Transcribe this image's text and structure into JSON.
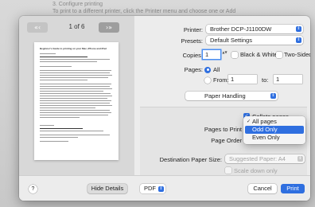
{
  "background": {
    "line1": "3. Configure printing",
    "line2": "To print to a different printer, click the Printer menu and choose one or Add"
  },
  "preview": {
    "page_count": "1 of 6",
    "first_btn": "«",
    "prev_btn": "‹",
    "next_btn": "›",
    "last_btn": "»",
    "thumbnail_title": "Beginner's Guide to printing on your Mac, iPhone and iPad"
  },
  "settings": {
    "printer_label": "Printer:",
    "printer_value": "Brother DCP-J1100DW",
    "presets_label": "Presets:",
    "presets_value": "Default Settings",
    "copies_label": "Copies:",
    "copies_value": "1",
    "bw_label": "Black & White",
    "two_sided_label": "Two-Sided",
    "pages_label": "Pages:",
    "pages_all": "All",
    "pages_from": "From:",
    "from_value": "1",
    "pages_to": "to:",
    "to_value": "1",
    "section_value": "Paper Handling",
    "collate_label": "Collate pages",
    "pages_to_print_label": "Pages to Print",
    "page_order_label": "Page Order",
    "dest_paper_label": "Destination Paper Size:",
    "dest_paper_value": "Suggested Paper: A4",
    "scale_down_label": "Scale down only"
  },
  "menu": {
    "items": [
      {
        "label": "All pages",
        "checked": true
      },
      {
        "label": "Odd Only",
        "highlighted": true
      },
      {
        "label": "Even Only"
      }
    ],
    "check_glyph": "✓"
  },
  "footer": {
    "help": "?",
    "hide_details": "Hide Details",
    "pdf": "PDF",
    "cancel": "Cancel",
    "print": "Print"
  },
  "icons": {
    "popup_arrow": "⇕",
    "stepper": "▲▼"
  },
  "colors": {
    "accent": "#2f6fe0"
  }
}
